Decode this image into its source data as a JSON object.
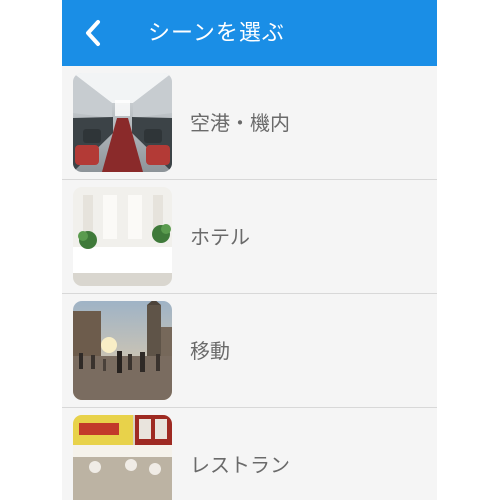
{
  "header": {
    "title": "シーンを選ぶ",
    "back_icon": "chevron-left-icon",
    "background_color": "#1a8ee6"
  },
  "scenes": [
    {
      "label": "空港・機内",
      "image": "airplane-cabin-photo"
    },
    {
      "label": "ホテル",
      "image": "hotel-lobby-photo"
    },
    {
      "label": "移動",
      "image": "city-street-photo"
    },
    {
      "label": "レストラン",
      "image": "restaurant-photo"
    }
  ]
}
